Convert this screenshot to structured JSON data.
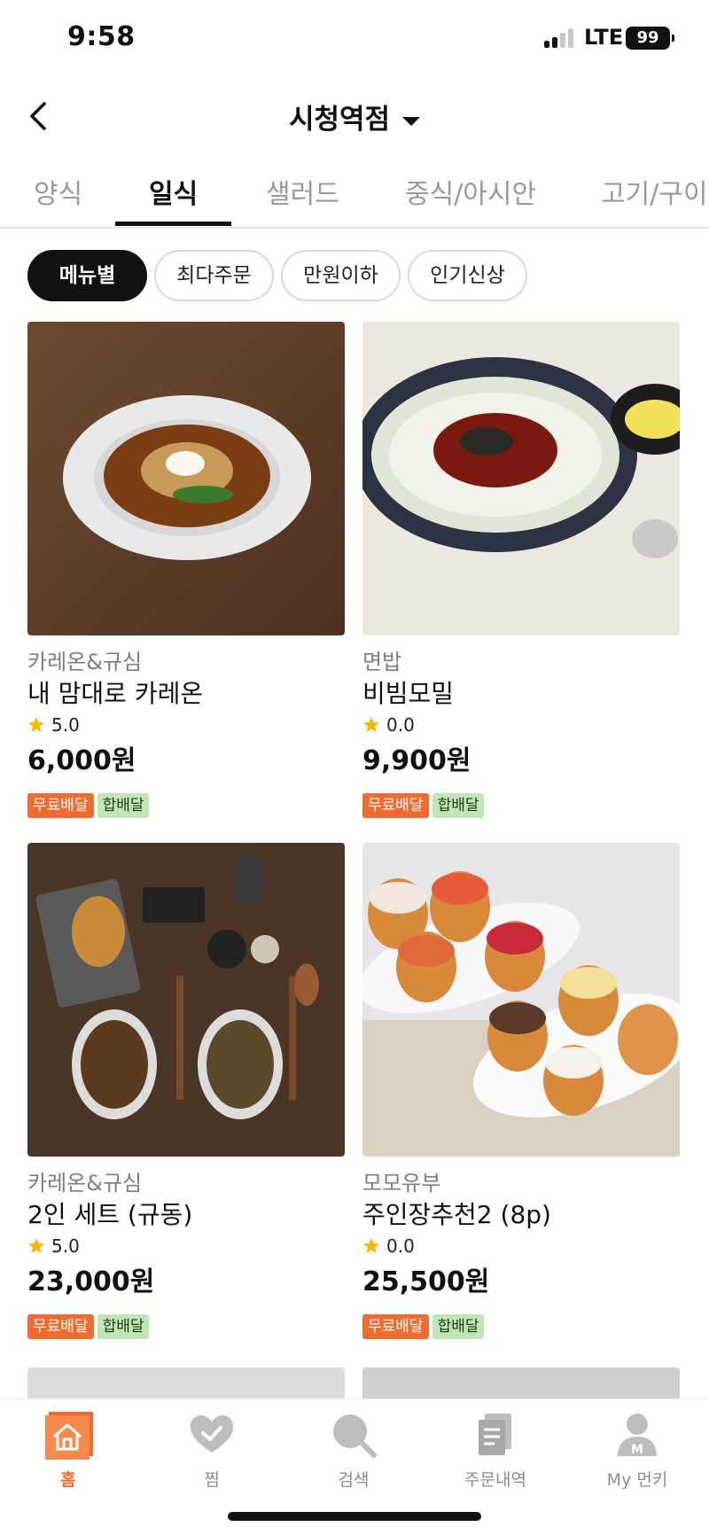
{
  "status": {
    "time": "9:58",
    "network": "LTE",
    "battery": "99"
  },
  "header": {
    "title": "시청역점"
  },
  "tabs": [
    "양식",
    "일식",
    "샐러드",
    "중식/아시안",
    "고기/구이"
  ],
  "active_tab": "일식",
  "filters": [
    "메뉴별",
    "최다주문",
    "만원이하",
    "인기신상"
  ],
  "active_filter": "메뉴별",
  "products": [
    {
      "brand": "카레온&규심",
      "name": "내 맘대로 카레온",
      "rating": "5.0",
      "price": "6,000원",
      "badges": [
        "무료배달",
        "합배달"
      ]
    },
    {
      "brand": "면밥",
      "name": "비빔모밀",
      "rating": "0.0",
      "price": "9,900원",
      "badges": [
        "무료배달",
        "합배달"
      ]
    },
    {
      "brand": "카레온&규심",
      "name": "2인 세트 (규동)",
      "rating": "5.0",
      "price": "23,000원",
      "badges": [
        "무료배달",
        "합배달"
      ]
    },
    {
      "brand": "모모유부",
      "name": "주인장추천2 (8p)",
      "rating": "0.0",
      "price": "25,500원",
      "badges": [
        "무료배달",
        "합배달"
      ]
    }
  ],
  "nav": [
    {
      "label": "홈",
      "icon": "home-icon"
    },
    {
      "label": "찜",
      "icon": "heart-icon"
    },
    {
      "label": "검색",
      "icon": "search-icon"
    },
    {
      "label": "주문내역",
      "icon": "order-history-icon"
    },
    {
      "label": "My 먼키",
      "icon": "profile-icon"
    }
  ],
  "colors": {
    "accent": "#f26a2e",
    "free_badge": "#f26a2e",
    "join_badge": "#bfe6b4",
    "star": "#f5b800"
  }
}
